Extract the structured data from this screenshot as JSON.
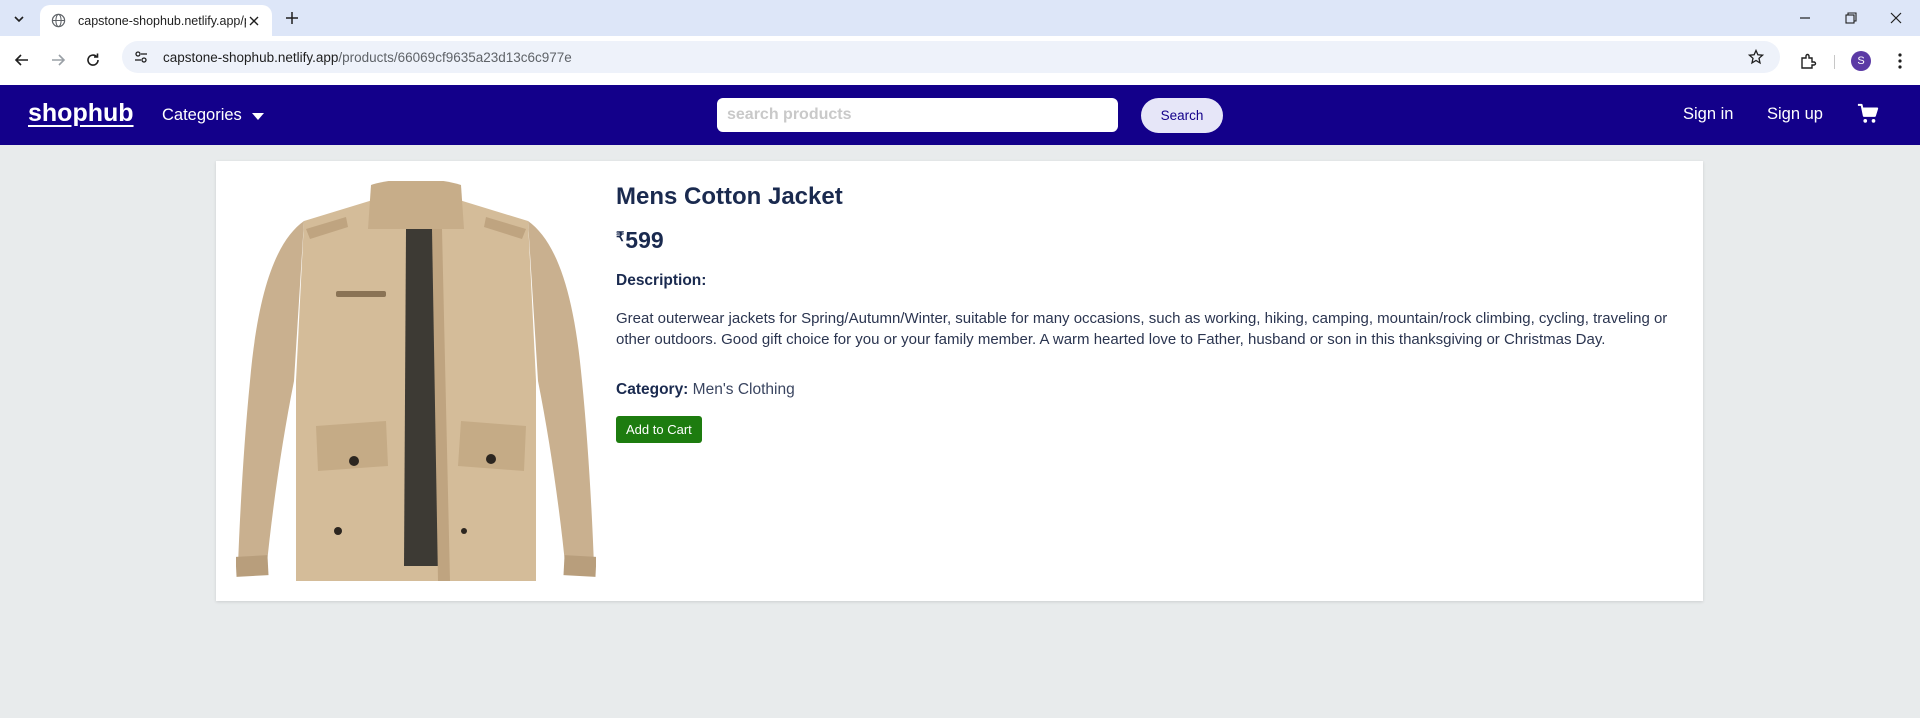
{
  "browser": {
    "tab_title": "capstone-shophub.netlify.app/p",
    "url_host": "capstone-shophub.netlify.app",
    "url_path": "/products/66069cf9635a23d13c6c977e",
    "profile_initial": "S"
  },
  "site": {
    "logo": "shophub",
    "categories_label": "Categories",
    "search_placeholder": "search products",
    "search_button": "Search",
    "sign_in": "Sign in",
    "sign_up": "Sign up",
    "brand_color": "#13008a"
  },
  "product": {
    "title": "Mens Cotton Jacket",
    "currency_symbol": "₹",
    "price": "599",
    "description_label": "Description:",
    "description": "Great outerwear jackets for Spring/Autumn/Winter, suitable for many occasions, such as working, hiking, camping, mountain/rock climbing, cycling, traveling or other outdoors. Good gift choice for you or your family member. A warm hearted love to Father, husband or son in this thanksgiving or Christmas Day.",
    "category_label": "Category:",
    "category": "Men's Clothing",
    "add_to_cart": "Add to Cart",
    "image_icon": "jacket-image"
  }
}
